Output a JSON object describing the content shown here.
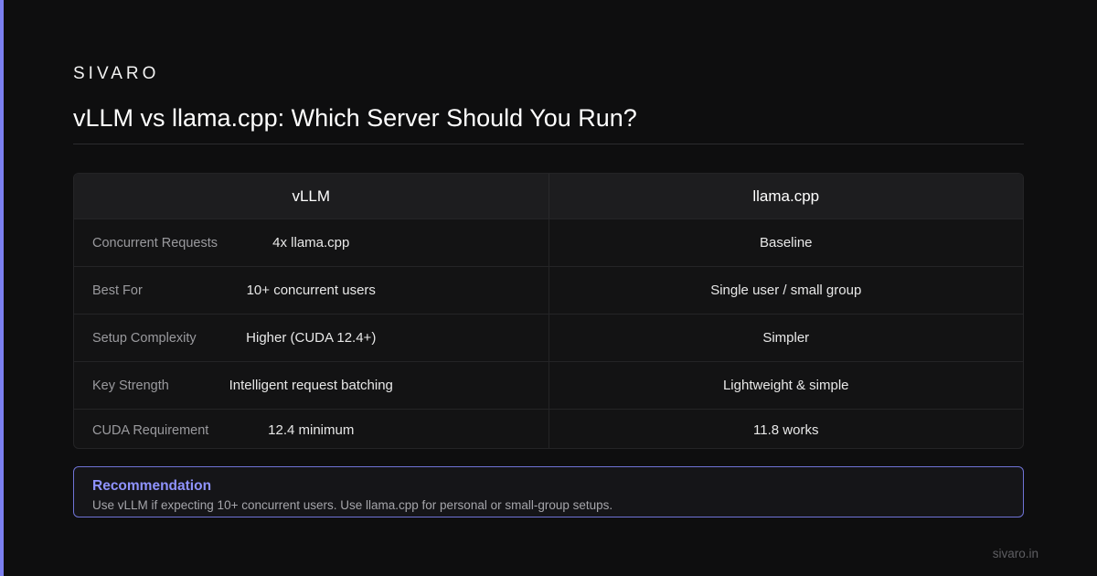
{
  "brand": "SIVARO",
  "title": "vLLM vs llama.cpp: Which Server Should You Run?",
  "table": {
    "headers": [
      "vLLM",
      "llama.cpp"
    ],
    "rows": [
      {
        "label": "Concurrent Requests",
        "vllm": "4x llama.cpp",
        "llamacpp": "Baseline"
      },
      {
        "label": "Best For",
        "vllm": "10+ concurrent users",
        "llamacpp": "Single user / small group"
      },
      {
        "label": "Setup Complexity",
        "vllm": "Higher (CUDA 12.4+)",
        "llamacpp": "Simpler"
      },
      {
        "label": "Key Strength",
        "vllm": "Intelligent request batching",
        "llamacpp": "Lightweight & simple"
      },
      {
        "label": "CUDA Requirement",
        "vllm": "12.4 minimum",
        "llamacpp": "11.8 works"
      }
    ]
  },
  "recommendation": {
    "title": "Recommendation",
    "text": "Use vLLM if expecting 10+ concurrent users. Use llama.cpp for personal or small-group setups."
  },
  "footer": "sivaro.in",
  "colors": {
    "accent": "#7b7ff0",
    "background": "#0e0e0f",
    "recommendation_title": "#8f93ff"
  }
}
